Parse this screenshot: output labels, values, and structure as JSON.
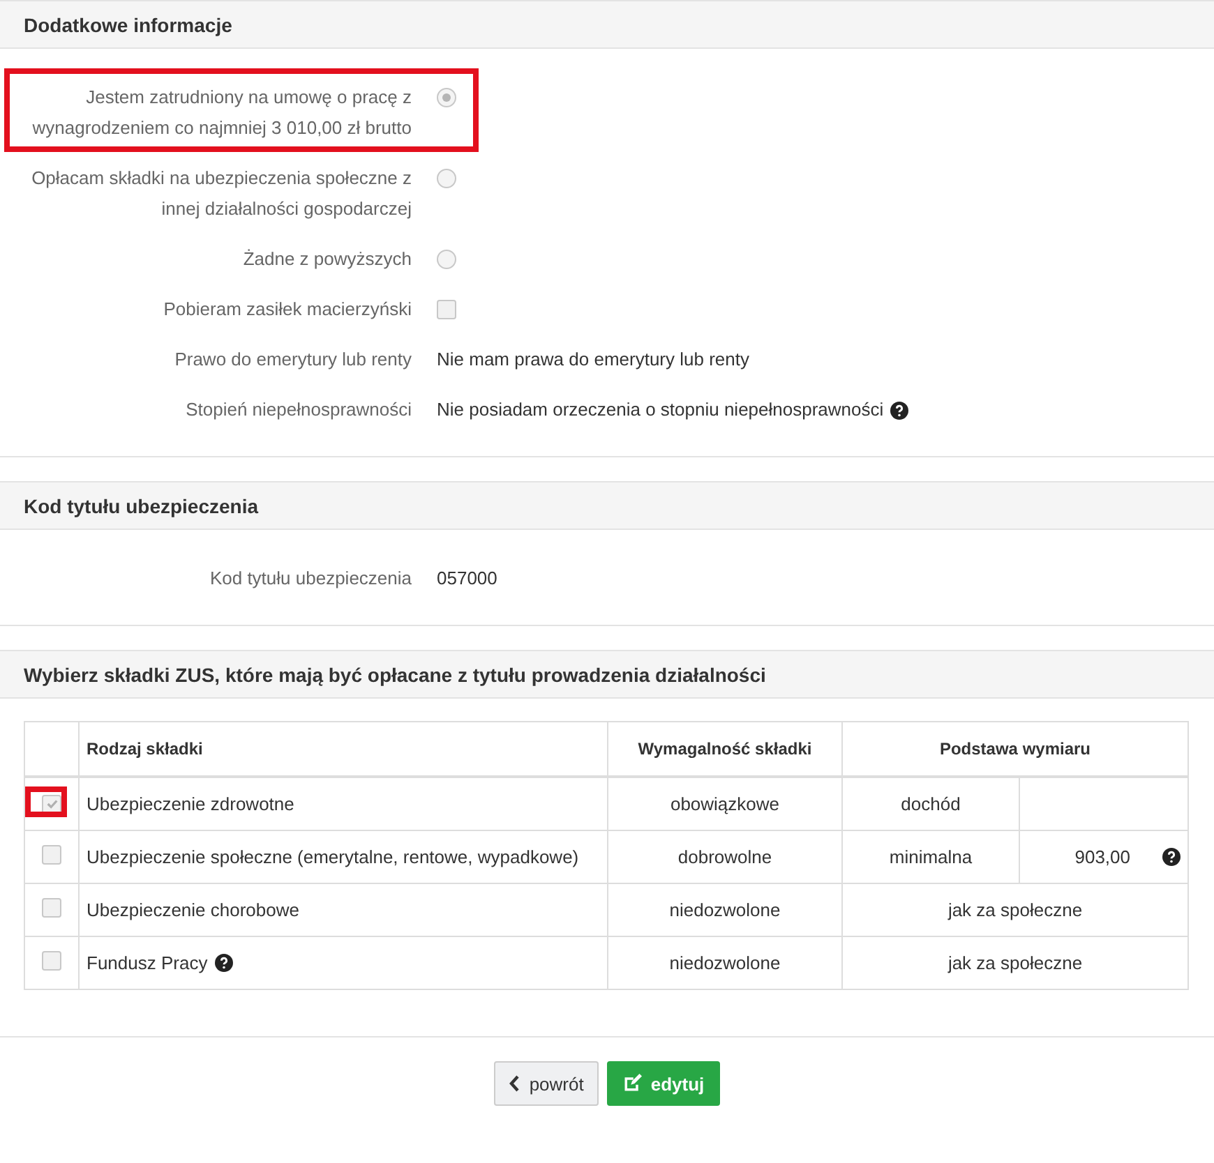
{
  "sections": [
    {
      "title": "Dodatkowe informacje",
      "fields": [
        {
          "kind": "radio",
          "label": "Jestem zatrudniony na umowę o pracę z wynagrodzeniem co najmniej 3 010,00 zł brutto",
          "selected": true,
          "highlighted": true
        },
        {
          "kind": "radio",
          "label": "Opłacam składki na ubezpieczenia społeczne z innej działalności gospodarczej",
          "selected": false,
          "highlighted": false
        },
        {
          "kind": "radio",
          "label": "Żadne z powyższych",
          "selected": false,
          "highlighted": false
        },
        {
          "kind": "checkbox",
          "label": "Pobieram zasiłek macierzyński",
          "checked": false,
          "highlighted": false
        },
        {
          "kind": "text",
          "label": "Prawo do emerytury lub renty",
          "value": "Nie mam prawa do emerytury lub renty",
          "help": false,
          "highlighted": false
        },
        {
          "kind": "text",
          "label": "Stopień niepełnosprawności",
          "value": "Nie posiadam orzeczenia o stopniu niepełnosprawności",
          "help": true,
          "highlighted": false
        }
      ]
    },
    {
      "title": "Kod tytułu ubezpieczenia",
      "fields": [
        {
          "kind": "text",
          "label": "Kod tytułu ubezpieczenia",
          "value": "057000",
          "help": false,
          "highlighted": false
        }
      ]
    }
  ],
  "contributions": {
    "title": "Wybierz składki ZUS, które mają być opłacane z tytułu prowadzenia działalności",
    "columns": [
      "Rodzaj składki",
      "Wymagalność składki",
      "Podstawa wymiaru"
    ],
    "rows": [
      {
        "name": "Ubezpieczenie zdrowotne",
        "name_help": false,
        "checked": true,
        "highlighted": true,
        "requirement": "obowiązkowe",
        "basis": "dochód",
        "amount": "",
        "amount_help": false
      },
      {
        "name": "Ubezpieczenie społeczne (emerytalne, rentowe, wypadkowe)",
        "name_help": false,
        "checked": false,
        "highlighted": false,
        "requirement": "dobrowolne",
        "basis": "minimalna",
        "amount": "903,00",
        "amount_help": true
      },
      {
        "name": "Ubezpieczenie chorobowe",
        "name_help": false,
        "checked": false,
        "highlighted": false,
        "requirement": "niedozwolone",
        "basis": "jak za społeczne",
        "merged": true
      },
      {
        "name": "Fundusz Pracy",
        "name_help": true,
        "checked": false,
        "highlighted": false,
        "requirement": "niedozwolone",
        "basis": "jak za społeczne",
        "merged": true
      }
    ]
  },
  "buttons": [
    {
      "kind": "back",
      "label": "powrót"
    },
    {
      "kind": "edit",
      "label": "edytuj"
    }
  ]
}
